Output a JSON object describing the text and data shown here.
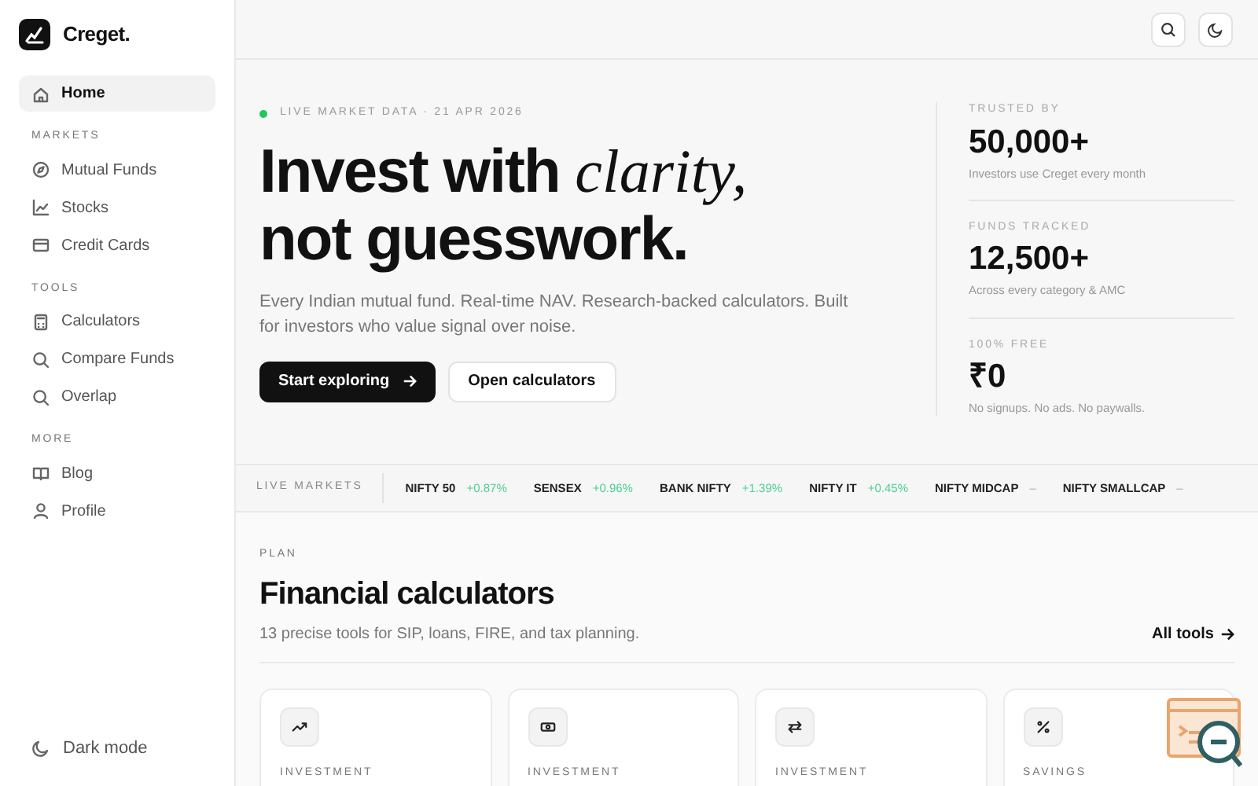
{
  "brand": {
    "name": "Creget."
  },
  "sidebar": {
    "sections": [
      {
        "items": [
          {
            "label": "Home",
            "selected": true
          }
        ]
      },
      {
        "heading": "MARKETS",
        "items": [
          {
            "label": "Mutual Funds",
            "selected": false
          },
          {
            "label": "Stocks",
            "selected": false
          },
          {
            "label": "Credit Cards",
            "selected": false
          }
        ]
      },
      {
        "heading": "TOOLS",
        "items": [
          {
            "label": "Calculators",
            "selected": false
          },
          {
            "label": "Compare Funds",
            "selected": false
          },
          {
            "label": "Overlap",
            "selected": false
          }
        ]
      },
      {
        "heading": "MORE",
        "items": [
          {
            "label": "Blog",
            "selected": false
          },
          {
            "label": "Profile",
            "selected": false
          }
        ]
      }
    ],
    "footer": {
      "label": "Dark mode"
    }
  },
  "hero": {
    "eyebrow": "LIVE MARKET DATA · 21 APR 2026",
    "headline_start": "Invest with",
    "headline_accent": "clarity,",
    "headline_end": "not guesswork.",
    "subtitle": "Every Indian mutual fund. Real-time NAV. Research-backed calculators. Built for investors who value signal over noise.",
    "primary_button": "Start exploring",
    "secondary_button": "Open calculators"
  },
  "stats": [
    {
      "label": "TRUSTED BY",
      "value": "50,000+",
      "note": "Investors use Creget every month"
    },
    {
      "label": "FUNDS TRACKED",
      "value": "12,500+",
      "note": "Across every category & AMC"
    },
    {
      "label": "100% FREE",
      "value": "₹0",
      "note": "No signups. No ads. No paywalls."
    }
  ],
  "ticker": {
    "label": "LIVE MARKETS",
    "items": [
      {
        "name": "NIFTY 50",
        "change": "+0.87%",
        "kind": "up"
      },
      {
        "name": "SENSEX",
        "change": "+0.96%",
        "kind": "up"
      },
      {
        "name": "BANK NIFTY",
        "change": "+1.39%",
        "kind": "up"
      },
      {
        "name": "NIFTY IT",
        "change": "+0.45%",
        "kind": "up"
      },
      {
        "name": "NIFTY MIDCAP",
        "change": "–",
        "kind": "flat"
      },
      {
        "name": "NIFTY SMALLCAP",
        "change": "–",
        "kind": "flat"
      }
    ]
  },
  "calculators": {
    "eyebrow": "PLAN",
    "title": "Financial calculators",
    "subtitle": "13 precise tools for SIP, loans, FIRE, and tax planning.",
    "link": "All tools",
    "cards": [
      {
        "category": "INVESTMENT"
      },
      {
        "category": "INVESTMENT"
      },
      {
        "category": "INVESTMENT"
      },
      {
        "category": "SAVINGS"
      }
    ]
  }
}
